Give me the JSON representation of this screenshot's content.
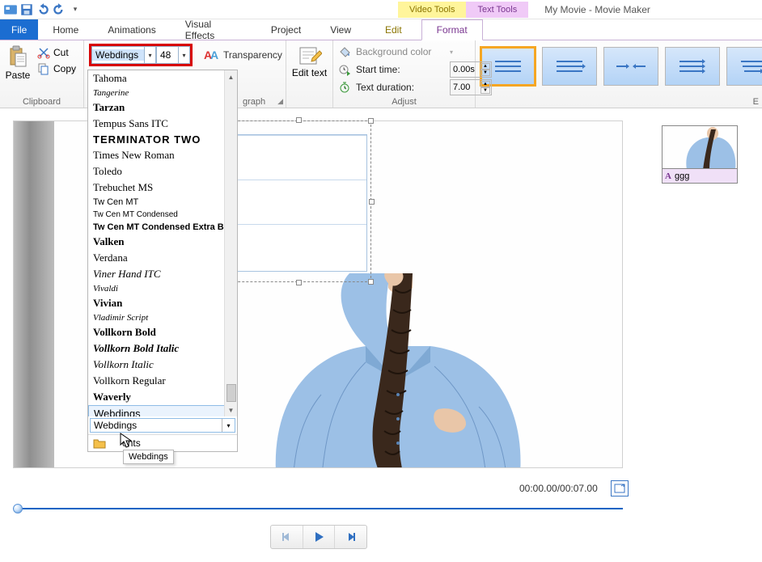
{
  "window": {
    "title": "My Movie - Movie Maker"
  },
  "context_tabs": {
    "video": "Video Tools",
    "text": "Text Tools",
    "video_sub": "Edit",
    "text_sub": "Format"
  },
  "tabs": {
    "file": "File",
    "home": "Home",
    "animations": "Animations",
    "vfx": "Visual Effects",
    "project": "Project",
    "view": "View"
  },
  "clipboard": {
    "label": "Clipboard",
    "paste": "Paste",
    "cut": "Cut",
    "copy": "Copy"
  },
  "font": {
    "name": "Webdings",
    "size": "48",
    "transparency": "Transparency",
    "paragraph": "graph"
  },
  "edit": {
    "label": "Edit\ntext"
  },
  "adjust": {
    "label": "Adjust",
    "bg": "Background color",
    "start": "Start time:",
    "dur": "Text duration:",
    "start_val": "0.00s",
    "dur_val": "7.00"
  },
  "font_list": [
    "Tahoma",
    "Tangerine",
    "Tarzan",
    "Tempus Sans ITC",
    "TERMINATOR TWO",
    "Times New Roman",
    "Toledo",
    "Trebuchet MS",
    "Tw Cen MT",
    "Tw Cen MT Condensed",
    "Tw Cen MT Condensed Extra Bold",
    "Valken",
    "Verdana",
    "Viner Hand ITC",
    "Vivaldi",
    "Vivian",
    "Vladimir Script",
    "Vollkorn Bold",
    "Vollkorn Bold Italic",
    "Vollkorn Italic",
    "Vollkorn Regular",
    "Waverly",
    "Webdings"
  ],
  "font_selected": "Webdings",
  "font_footer": "onts",
  "tooltip": "Webdings",
  "timecode": "00:00.00/00:07.00",
  "caption": {
    "prefix": "A",
    "text": "ggg"
  },
  "right_letter": "E"
}
